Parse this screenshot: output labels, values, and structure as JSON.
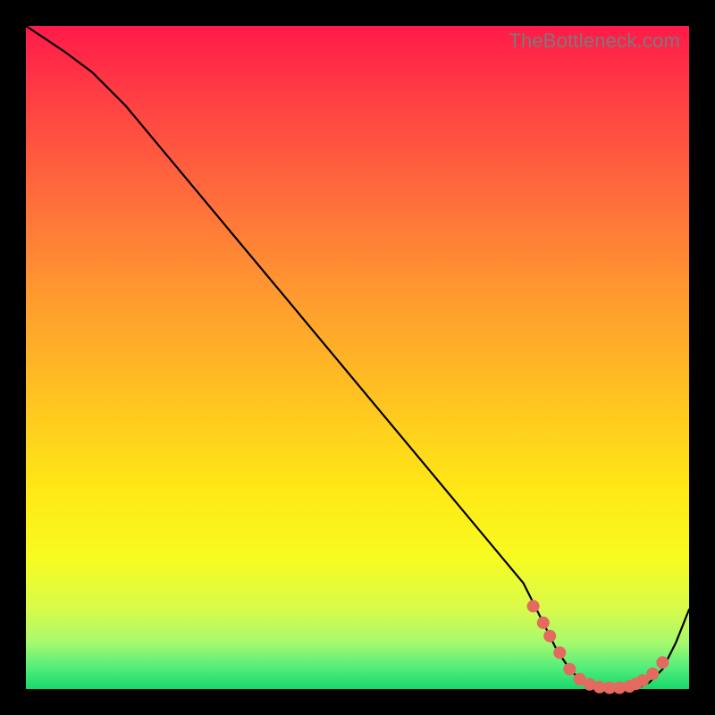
{
  "watermark": "TheBottleneck.com",
  "colors": {
    "background": "#000000",
    "gradient_top": "#ff1a49",
    "gradient_bottom": "#17d86b",
    "line": "#000000",
    "dot": "#e4695f"
  },
  "chart_data": {
    "type": "line",
    "title": "",
    "xlabel": "",
    "ylabel": "",
    "xlim": [
      0,
      100
    ],
    "ylim": [
      0,
      100
    ],
    "series": [
      {
        "name": "bottleneck-curve",
        "x": [
          0,
          3,
          6,
          10,
          15,
          20,
          30,
          40,
          50,
          60,
          70,
          75,
          78,
          80,
          82,
          84,
          86,
          88,
          90,
          92,
          94,
          96,
          98,
          100
        ],
        "y": [
          100,
          98,
          96,
          93,
          88,
          82,
          70,
          58,
          46,
          34,
          22,
          16,
          10,
          6,
          3,
          1,
          0,
          0,
          0,
          0,
          1,
          3,
          7,
          12
        ]
      }
    ],
    "markers": {
      "name": "highlight-dots",
      "x": [
        76.5,
        78.0,
        79.0,
        80.5,
        82.0,
        83.5,
        85.0,
        86.5,
        88.0,
        89.5,
        91.0,
        92.0,
        93.0,
        94.5,
        96.0
      ],
      "y": [
        12.5,
        10.0,
        8.0,
        5.5,
        3.0,
        1.5,
        0.7,
        0.3,
        0.2,
        0.2,
        0.4,
        0.8,
        1.3,
        2.3,
        4.0
      ]
    }
  }
}
